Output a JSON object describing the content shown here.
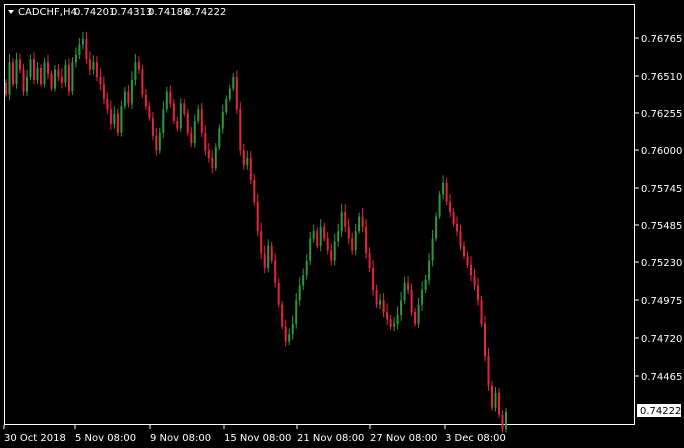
{
  "header": {
    "symbol": "CADCHF,H4",
    "open": "0.74201",
    "high": "0.74313",
    "low": "0.74186",
    "close": "0.74222"
  },
  "price_axis": {
    "ticks": [
      "0.76765",
      "0.76510",
      "0.76255",
      "0.76000",
      "0.75745",
      "0.75485",
      "0.75230",
      "0.74975",
      "0.74720",
      "0.74465"
    ],
    "current_price": "0.74222"
  },
  "time_axis": {
    "ticks": [
      "30 Oct 2018",
      "5 Nov 08:00",
      "9 Nov 08:00",
      "15 Nov 08:00",
      "21 Nov 08:00",
      "27 Nov 08:00",
      "3 Dec 08:00"
    ]
  },
  "colors": {
    "background": "#000000",
    "bull": "#2e9a3c",
    "bear": "#e8243c",
    "frame": "#ffffff",
    "text": "#ffffff"
  },
  "chart_data": {
    "type": "candlestick",
    "symbol": "CADCHF",
    "timeframe": "H4",
    "ylim": [
      0.7411,
      0.7702
    ],
    "close_series": [
      0.7638,
      0.766,
      0.7645,
      0.7662,
      0.7655,
      0.764,
      0.765,
      0.7662,
      0.7648,
      0.7656,
      0.7645,
      0.766,
      0.7652,
      0.7642,
      0.7655,
      0.765,
      0.7646,
      0.7658,
      0.764,
      0.766,
      0.7665,
      0.7672,
      0.7676,
      0.7662,
      0.7655,
      0.766,
      0.765,
      0.7645,
      0.7635,
      0.7628,
      0.7618,
      0.7625,
      0.7612,
      0.763,
      0.764,
      0.7632,
      0.7648,
      0.766,
      0.7655,
      0.7638,
      0.763,
      0.7622,
      0.761,
      0.76,
      0.7612,
      0.7628,
      0.764,
      0.7632,
      0.762,
      0.7615,
      0.7632,
      0.7625,
      0.7612,
      0.7605,
      0.762,
      0.7628,
      0.7612,
      0.76,
      0.7595,
      0.7588,
      0.7602,
      0.7615,
      0.7626,
      0.7635,
      0.7642,
      0.765,
      0.7628,
      0.76,
      0.759,
      0.7595,
      0.758,
      0.7565,
      0.7545,
      0.753,
      0.752,
      0.7535,
      0.7525,
      0.751,
      0.7495,
      0.748,
      0.747,
      0.7475,
      0.7482,
      0.7498,
      0.7508,
      0.7515,
      0.7525,
      0.754,
      0.7545,
      0.7535,
      0.7548,
      0.754,
      0.7532,
      0.7525,
      0.7538,
      0.7545,
      0.7558,
      0.7548,
      0.754,
      0.7532,
      0.7545,
      0.7555,
      0.7548,
      0.753,
      0.752,
      0.7505,
      0.7495,
      0.7498,
      0.749,
      0.7485,
      0.748,
      0.7482,
      0.7488,
      0.7498,
      0.751,
      0.7505,
      0.749,
      0.7482,
      0.7495,
      0.7505,
      0.7512,
      0.7525,
      0.754,
      0.7555,
      0.757,
      0.7578,
      0.7565,
      0.7558,
      0.755,
      0.7545,
      0.7535,
      0.7528,
      0.7522,
      0.7515,
      0.7508,
      0.7498,
      0.7482,
      0.746,
      0.744,
      0.7425,
      0.7435,
      0.742,
      0.741,
      0.7422
    ]
  }
}
